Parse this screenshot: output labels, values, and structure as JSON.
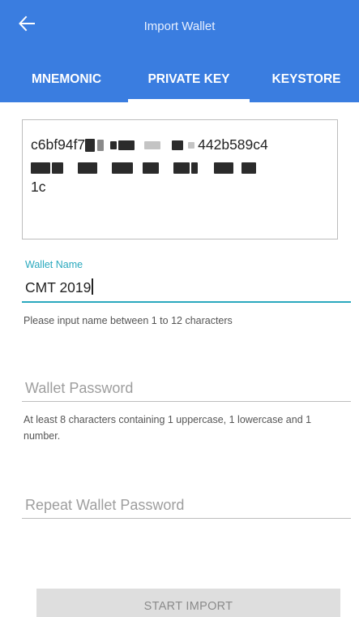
{
  "header": {
    "title": "Import Wallet",
    "back_icon": "arrow-left-icon",
    "background_color": "#3a7de0"
  },
  "tabs": [
    {
      "label": "MNEMONIC",
      "selected": false
    },
    {
      "label": "PRIVATE KEY",
      "selected": true
    },
    {
      "label": "KEYSTORE",
      "selected": false
    }
  ],
  "private_key": {
    "line1_start": "c6bf94f7",
    "line1_end": "442b589c4",
    "line3": "1c",
    "redacted": true
  },
  "wallet_name": {
    "label": "Wallet Name",
    "value": "CMT 2019",
    "hint": "Please input name between 1 to 12 characters",
    "accent_color": "#2aa9be"
  },
  "wallet_password": {
    "placeholder": "Wallet Password",
    "hint": "At least 8 characters containing 1 uppercase, 1 lowercase and 1 number."
  },
  "repeat_password": {
    "placeholder": "Repeat Wallet Password"
  },
  "actions": {
    "start_import_label": "START IMPORT",
    "start_import_enabled": false
  }
}
